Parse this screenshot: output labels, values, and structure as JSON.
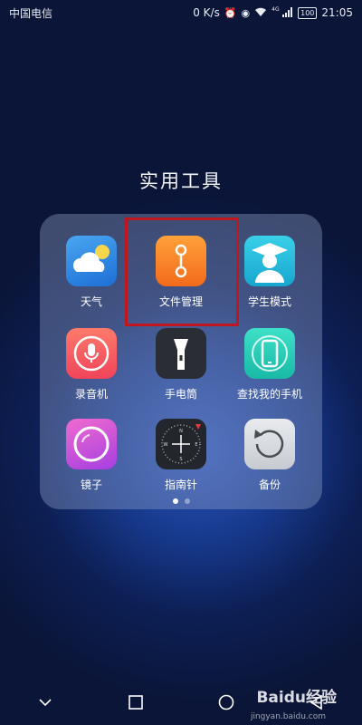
{
  "status_bar": {
    "carrier": "中国电信",
    "net_speed": "0 K/s",
    "signal_label": "4G",
    "battery": "100",
    "time": "21:05"
  },
  "folder": {
    "title": "实用工具",
    "apps": [
      {
        "label": "天气",
        "icon": "weather-icon"
      },
      {
        "label": "文件管理",
        "icon": "file-manager-icon"
      },
      {
        "label": "学生模式",
        "icon": "student-mode-icon"
      },
      {
        "label": "录音机",
        "icon": "recorder-icon"
      },
      {
        "label": "手电筒",
        "icon": "flashlight-icon"
      },
      {
        "label": "查找我的手机",
        "icon": "find-my-phone-icon"
      },
      {
        "label": "镜子",
        "icon": "mirror-icon"
      },
      {
        "label": "指南针",
        "icon": "compass-icon"
      },
      {
        "label": "备份",
        "icon": "backup-icon"
      }
    ],
    "page_count": 2,
    "active_page": 1
  },
  "nav_bar": {
    "buttons": [
      "back-icon",
      "recents-icon",
      "home-icon",
      "collapse-icon"
    ]
  },
  "watermark": {
    "brand": "Baidu经验",
    "url": "jingyan.baidu.com"
  },
  "colors": {
    "highlight": "#c0161d"
  }
}
